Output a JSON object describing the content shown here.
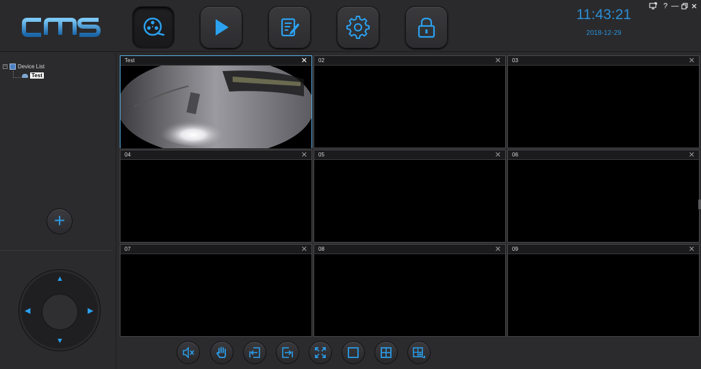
{
  "app": {
    "logo_text": "CMS"
  },
  "header": {
    "nav": [
      {
        "id": "live",
        "icon": "film-reel-icon"
      },
      {
        "id": "playback",
        "icon": "play-icon"
      },
      {
        "id": "log",
        "icon": "edit-document-icon"
      },
      {
        "id": "settings",
        "icon": "gear-icon"
      },
      {
        "id": "lock",
        "icon": "lock-icon"
      }
    ],
    "time": "11:43:21",
    "date": "2018-12-29",
    "window_controls": [
      "monitor-icon",
      "help-icon",
      "minimize-icon",
      "restore-icon",
      "close-icon"
    ]
  },
  "sidebar": {
    "tree_toggle": "−",
    "root_label": "Device List",
    "children": [
      "Test"
    ],
    "add_label": "+"
  },
  "ptz": {
    "up": "▲",
    "down": "▼",
    "left": "◀",
    "right": "▶"
  },
  "channels": [
    {
      "title": "Test",
      "close": "✕"
    },
    {
      "title": "02",
      "close": "✕"
    },
    {
      "title": "03",
      "close": "✕"
    },
    {
      "title": "04",
      "close": "✕"
    },
    {
      "title": "05",
      "close": "✕"
    },
    {
      "title": "06",
      "close": "✕"
    },
    {
      "title": "07",
      "close": "✕"
    },
    {
      "title": "08",
      "close": "✕"
    },
    {
      "title": "09",
      "close": "✕"
    }
  ],
  "toolbar": [
    "mute-icon",
    "hand-icon",
    "previous-group-icon",
    "next-group-icon",
    "fullscreen-icon",
    "single-layout-icon",
    "quad-layout-icon",
    "multi-layout-icon"
  ],
  "colors": {
    "accent": "#2b9be8",
    "background": "#2b2b2d",
    "selected_border": "#5ab1e6"
  }
}
